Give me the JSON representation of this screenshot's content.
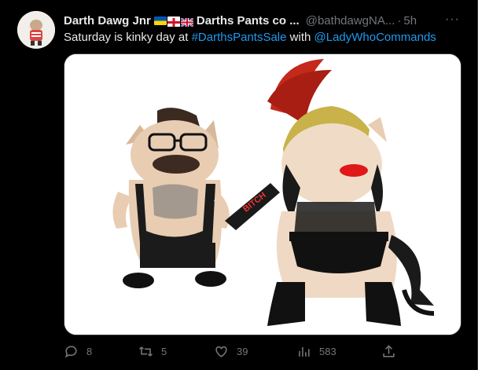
{
  "tweet": {
    "author_name": "Darth Dawg Jnr",
    "author_name_suffix": "Darths Pants co ...",
    "handle": "@bathdawgNA...",
    "dot": "·",
    "time": "5h",
    "more": "···",
    "text_before": "Saturday is kinky day at ",
    "hashtag": "#DarthsPantsSale",
    "text_middle": " with ",
    "mention": "@LadyWhoCommands",
    "paddle_text": "BITCH"
  },
  "actions": {
    "replies": "8",
    "retweets": "5",
    "likes": "39",
    "views": "583"
  },
  "colors": {
    "link": "#1d9bf0",
    "muted": "#71767b",
    "text": "#e7e9ea",
    "background": "#000000"
  },
  "icons": [
    "reply-icon",
    "retweet-icon",
    "like-icon",
    "views-icon",
    "share-icon",
    "more-icon"
  ]
}
